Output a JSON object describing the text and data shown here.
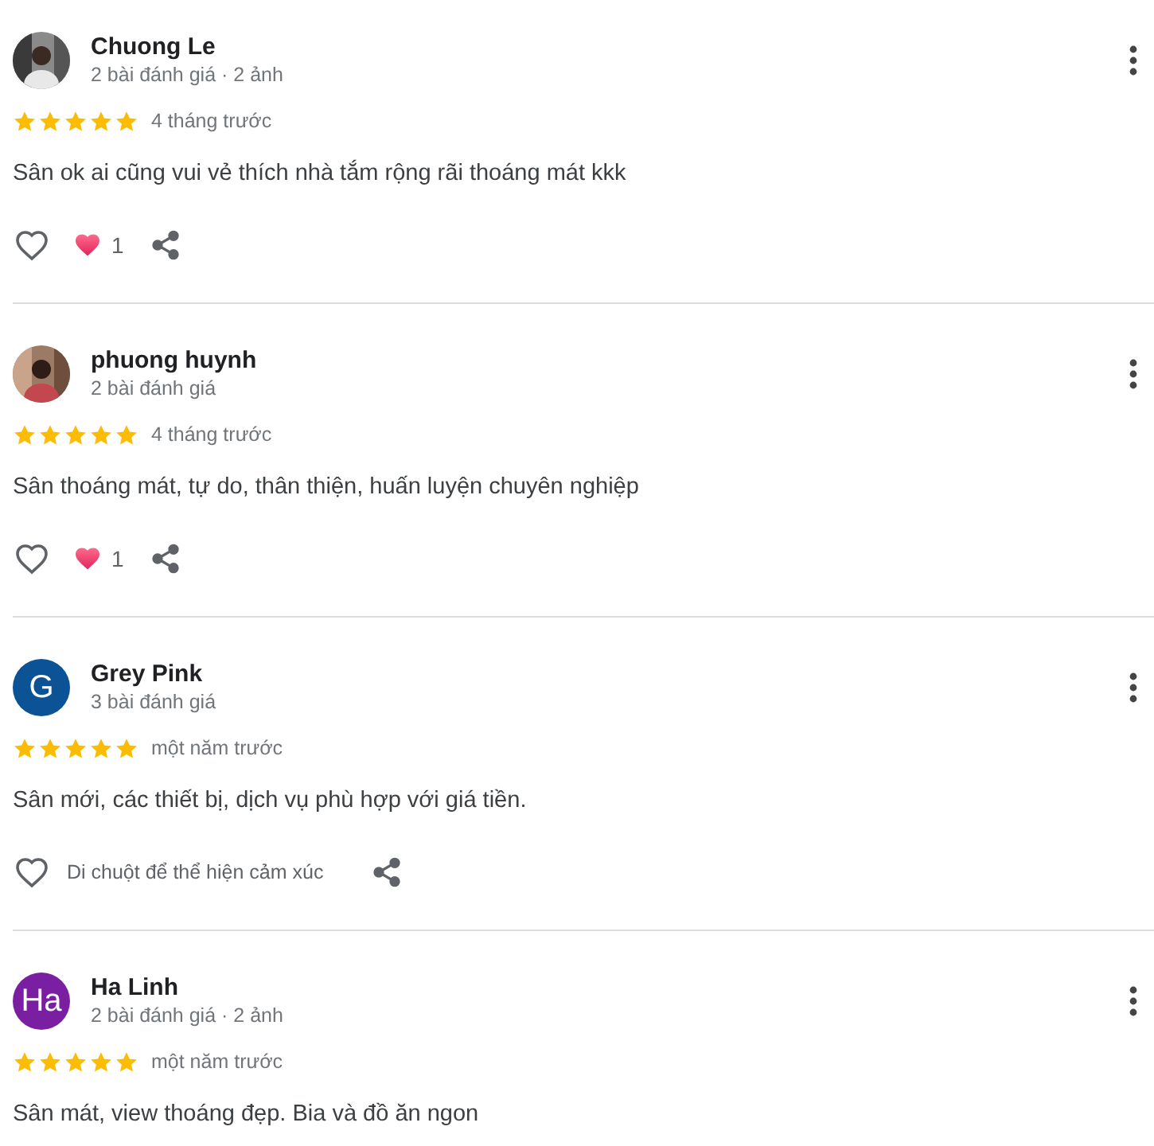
{
  "reviews": [
    {
      "name": "Chuong Le",
      "meta": "2 bài đánh giá · 2 ảnh",
      "stars": 5,
      "time": "4 tháng trước",
      "text": "Sân ok ai cũng vui vẻ thích nhà tắm rộng rãi thoáng mát kkk",
      "actions": {
        "reaction_count": "1"
      }
    },
    {
      "name": "phuong huynh",
      "meta": "2 bài đánh giá",
      "stars": 5,
      "time": "4 tháng trước",
      "text": "Sân thoáng mát, tự do, thân thiện, huấn luyện chuyên nghiệp",
      "actions": {
        "reaction_count": "1"
      }
    },
    {
      "name": "Grey Pink",
      "meta": "3 bài đánh giá",
      "avatar": {
        "kind": "letter",
        "letter": "G",
        "color": "#0b5394"
      },
      "stars": 5,
      "time": "một năm trước",
      "text": "Sân mới, các thiết bị, dịch vụ phù hợp với giá tiền.",
      "actions": {
        "hint": "Di chuột để thể hiện cảm xúc"
      }
    },
    {
      "name": "Ha Linh",
      "meta": "2 bài đánh giá · 2 ảnh",
      "avatar": {
        "kind": "letter",
        "letter": "Ha",
        "color": "#7b1fa2"
      },
      "stars": 5,
      "time": "một năm trước",
      "text": "Sân mát, view thoáng đẹp. Bia và đồ ăn ngon"
    }
  ]
}
